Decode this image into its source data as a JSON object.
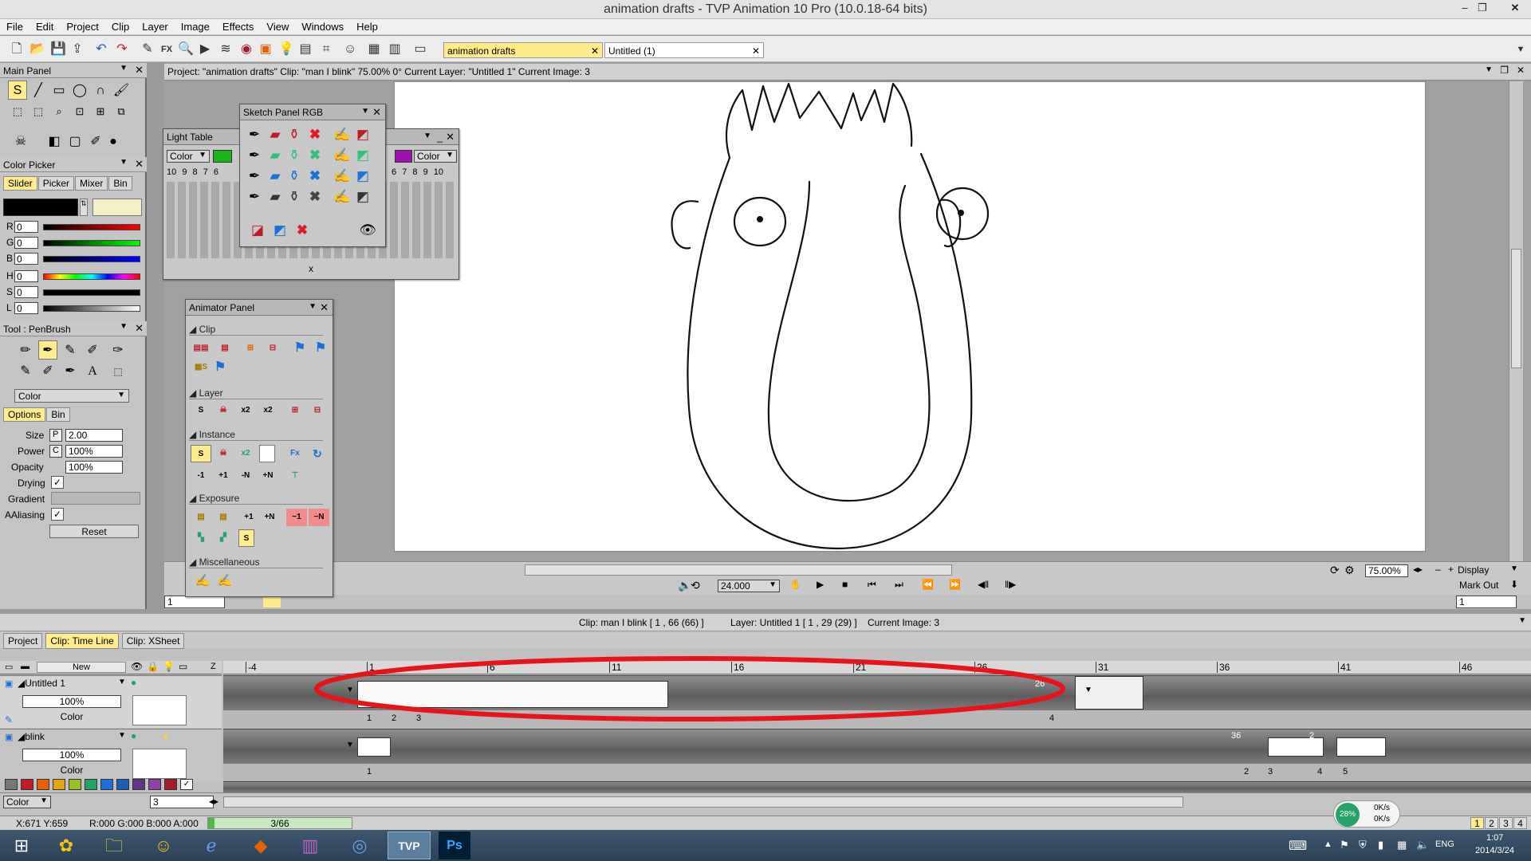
{
  "window": {
    "title": "animation drafts - TVP Animation 10 Pro (10.0.18-64 bits)"
  },
  "menu": [
    "File",
    "Edit",
    "Project",
    "Clip",
    "Layer",
    "Image",
    "Effects",
    "View",
    "Windows",
    "Help"
  ],
  "doc_tabs": [
    {
      "label": "animation drafts",
      "active": true
    },
    {
      "label": "Untitled (1)",
      "active": false
    }
  ],
  "main_panel": {
    "title": "Main Panel",
    "color_picker": {
      "title": "Color Picker",
      "tabs": [
        "Slider",
        "Picker",
        "Mixer",
        "Bin"
      ],
      "sliders": [
        {
          "label": "R",
          "value": "0"
        },
        {
          "label": "G",
          "value": "0"
        },
        {
          "label": "B",
          "value": "0"
        },
        {
          "label": "H",
          "value": "0"
        },
        {
          "label": "S",
          "value": "0"
        },
        {
          "label": "L",
          "value": "0"
        }
      ]
    },
    "tool": {
      "title": "Tool : PenBrush",
      "mode": "Color",
      "tabs": [
        "Options",
        "Bin"
      ],
      "size_label": "Size",
      "size_flag": "P",
      "size": "2.00",
      "power_label": "Power",
      "power_flag": "C",
      "power": "100%",
      "opacity_label": "Opacity",
      "opacity": "100%",
      "drying_label": "Drying",
      "gradient_label": "Gradient",
      "aliasing_label": "AAliasing",
      "reset": "Reset"
    }
  },
  "info_bar": "Project: \"animation drafts\"  Clip: \"man I blink\"  75.00%  0°  Current Layer: \"Untitled 1\"  Current Image: 3",
  "light_table": {
    "title": "Light Table",
    "mode_left": "Color",
    "mode_right": "Color",
    "numbers_left": [
      "10",
      "9",
      "8",
      "7",
      "6"
    ],
    "numbers_right": [
      "6",
      "7",
      "8",
      "9",
      "10"
    ],
    "x_label": "x"
  },
  "sketch_panel": {
    "title": "Sketch Panel RGB"
  },
  "animator_panel": {
    "title": "Animator Panel",
    "sections": [
      "Clip",
      "Layer",
      "Instance",
      "Exposure",
      "Miscellaneous"
    ],
    "labels": {
      "s": "S",
      "x2": "x2",
      "plus1": "+1",
      "plusN": "+N",
      "minus1": "−1",
      "minusN": "−N",
      "fx": "Fx",
      "m1": "-1",
      "p1": "+1",
      "mN": "-N",
      "pN": "+N"
    }
  },
  "view_controls": {
    "zoom": "75.00%",
    "display": "Display",
    "fps": "24.000",
    "mark_out": "Mark Out",
    "frame_in": "1",
    "frame_out": "1"
  },
  "timeline": {
    "status_clip": "Clip: man I blink [ 1 , 66  (66) ]",
    "status_layer": "Layer: Untitled 1 [ 1 , 29  (29) ]",
    "status_image": "Current Image: 3",
    "tabs": [
      "Project",
      "Clip: Time Line",
      "Clip: XSheet"
    ],
    "new_label": "New",
    "z_label": "Z",
    "ruler": [
      "-4",
      "1",
      "6",
      "11",
      "16",
      "21",
      "26",
      "31",
      "36",
      "41",
      "46"
    ],
    "layers": [
      {
        "name": "Untitled 1",
        "opacity": "100%",
        "mode": "Color",
        "frames": [
          "1",
          "2",
          "3",
          "4"
        ],
        "end_label": "26"
      },
      {
        "name": "blink",
        "opacity": "100%",
        "mode": "Color",
        "frames": [
          "1",
          "2",
          "3",
          "4",
          "5"
        ],
        "labels_top": [
          "36",
          "2"
        ]
      }
    ],
    "bottom_mode": "Color",
    "bottom_value": "3"
  },
  "status_bar": {
    "coords": "X:671  Y:659",
    "rgba": "R:000 G:000 B:000 A:000",
    "progress_text": "3/66",
    "progress": 0.045,
    "net_pct": "28%",
    "net_up": "0K/s",
    "net_down": "0K/s",
    "pages": [
      "1",
      "2",
      "3",
      "4"
    ]
  },
  "taskbar": {
    "lang": "ENG",
    "time": "1:07",
    "date": "2014/3/24",
    "apps": [
      "start",
      "photos",
      "explorer",
      "qq",
      "ie",
      "app",
      "winrar",
      "search",
      "TVP",
      "Ps"
    ]
  }
}
